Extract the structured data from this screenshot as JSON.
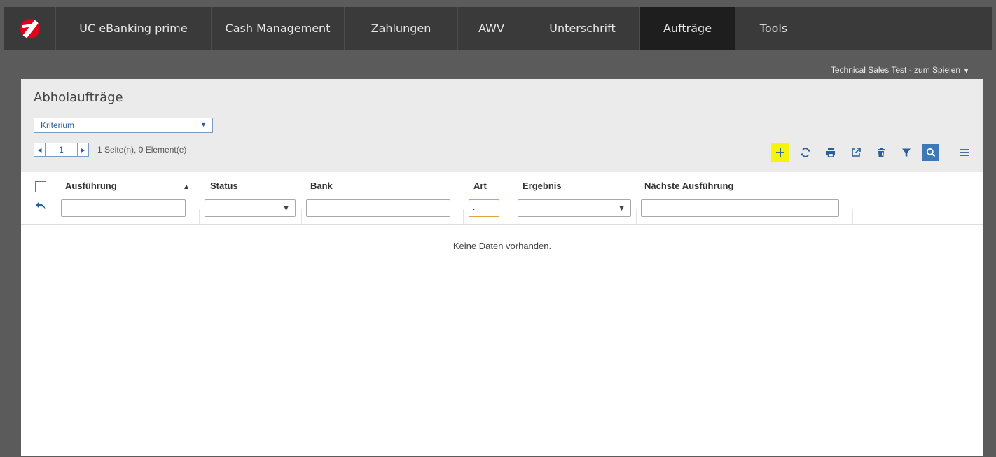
{
  "nav": {
    "logo_alt": "UniCredit",
    "items": [
      {
        "label": "UC eBanking prime"
      },
      {
        "label": "Cash Management"
      },
      {
        "label": "Zahlungen"
      },
      {
        "label": "AWV"
      },
      {
        "label": "Unterschrift"
      },
      {
        "label": "Aufträge",
        "active": true
      },
      {
        "label": "Tools"
      }
    ]
  },
  "context": {
    "label": "Technical Sales Test - zum Spielen"
  },
  "page": {
    "title": "Abholaufträge"
  },
  "criterion": {
    "selected": "Kriterium"
  },
  "pager": {
    "page": "1",
    "info": "1 Seite(n), 0 Element(e)"
  },
  "toolbar": {
    "icons": [
      "plus-icon",
      "refresh-icon",
      "print-icon",
      "export-icon",
      "delete-icon",
      "filter-icon",
      "search-icon",
      "menu-icon"
    ]
  },
  "table": {
    "columns": [
      "Ausführung",
      "Status",
      "Bank",
      "Art",
      "Ergebnis",
      "Nächste Ausführung"
    ],
    "filters": {
      "art_value": "."
    },
    "empty_text": "Keine Daten vorhanden."
  },
  "colors": {
    "nav_bg": "#3a3a3a",
    "nav_active": "#1e1e1e",
    "accent": "#2a5f9e",
    "highlight": "#f5f50a",
    "brand": "#e2001a"
  }
}
